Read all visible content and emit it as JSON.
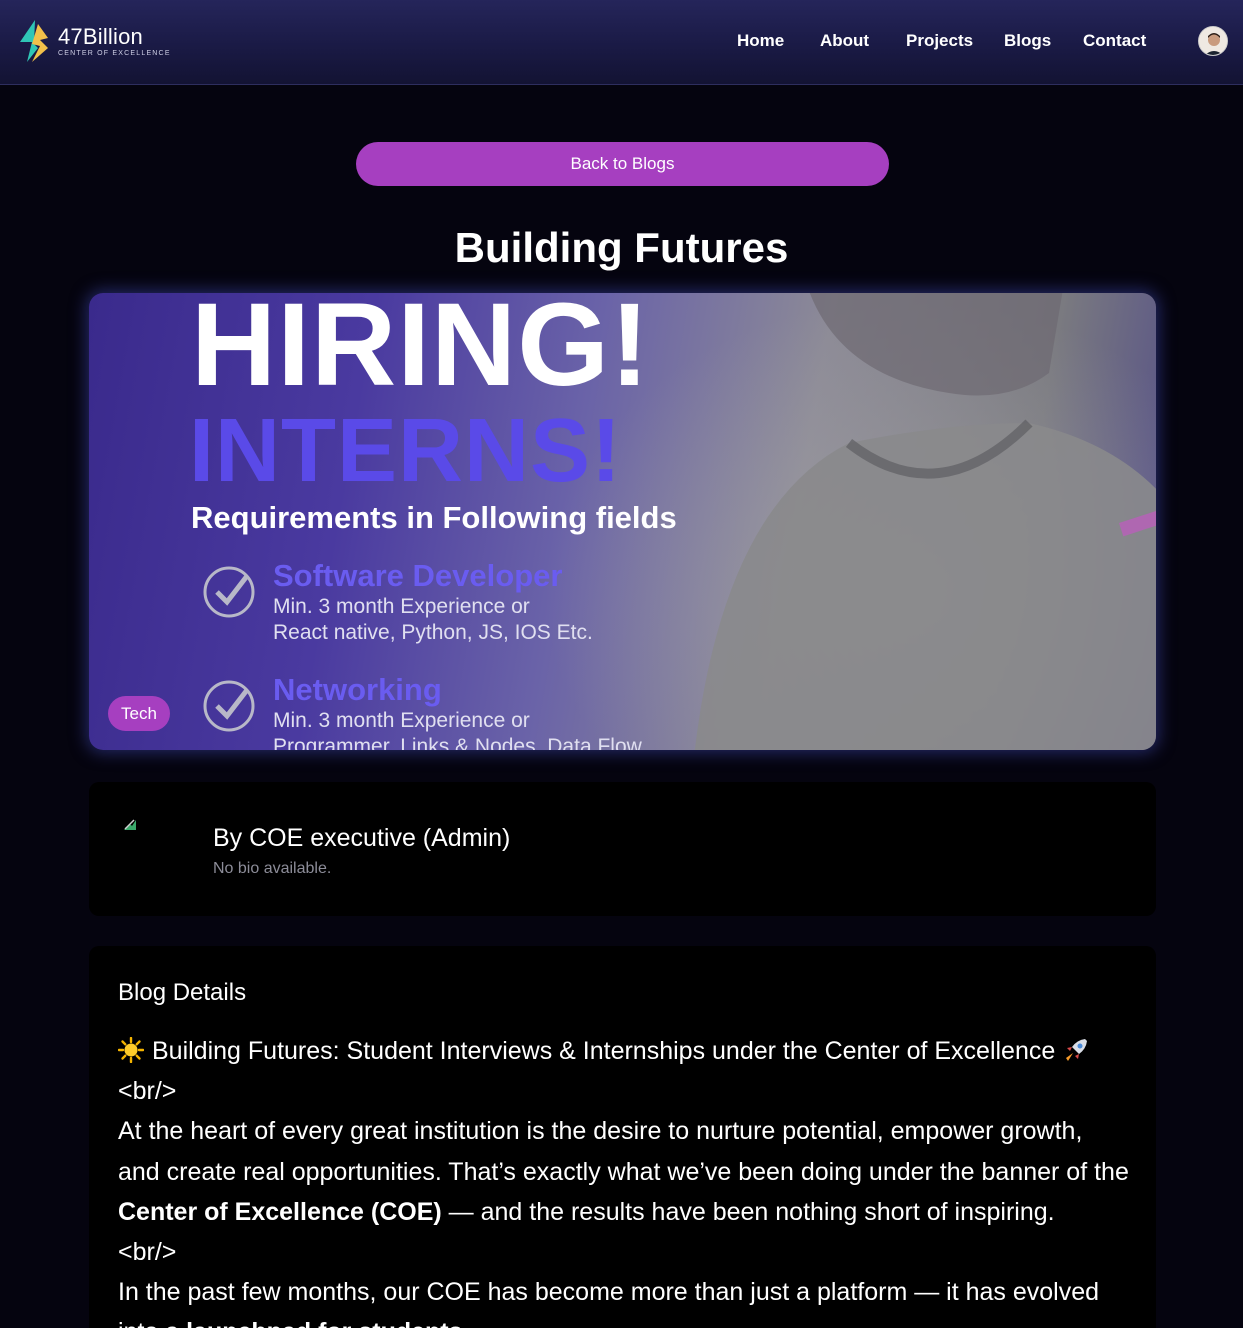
{
  "brand": {
    "name": "47Billion",
    "subtitle": "CENTER OF EXCELLENCE"
  },
  "nav": {
    "items": [
      {
        "label": "Home"
      },
      {
        "label": "About"
      },
      {
        "label": "Projects"
      },
      {
        "label": "Blogs"
      },
      {
        "label": "Contact"
      }
    ]
  },
  "back_button": {
    "label": "Back to Blogs"
  },
  "post": {
    "title": "Building Futures",
    "tag": "Tech",
    "hero_image": {
      "heading_1": "HIRING!",
      "heading_2": "INTERNS!",
      "requirements_label": "Requirements in Following fields",
      "items": [
        {
          "title": "Software Developer",
          "line_1": "Min. 3 month Experience or",
          "line_2": "React native, Python, JS, IOS Etc."
        },
        {
          "title": "Networking",
          "line_1": "Min. 3 month Experience or",
          "line_2": "Programmer, Links & Nodes, Data Flow"
        }
      ]
    }
  },
  "author": {
    "name": "By COE executive (Admin)",
    "bio": "No bio available."
  },
  "details": {
    "heading": "Blog Details",
    "lines": {
      "l1": "Building Futures: Student Interviews & Internships under the Center of Excellence",
      "br1": "<br/>",
      "l2": "At the heart of every great institution is the desire to nurture potential, empower growth,",
      "l3": "and create real opportunities. That’s exactly what we’ve been doing under the banner of the",
      "l4_bold": "Center of Excellence (COE)",
      "l4_rest": " — and the results have been nothing short of inspiring.",
      "br2": "<br/>",
      "l5": "In the past few months, our COE has become more than just a platform — it has evolved",
      "l6_start": "into ",
      "l6_bold": "a launchpad for students"
    }
  },
  "colors": {
    "accent": "#a63fc0",
    "background": "#05040f",
    "card": "#000000",
    "hero_purple": "#5a4ae8"
  }
}
